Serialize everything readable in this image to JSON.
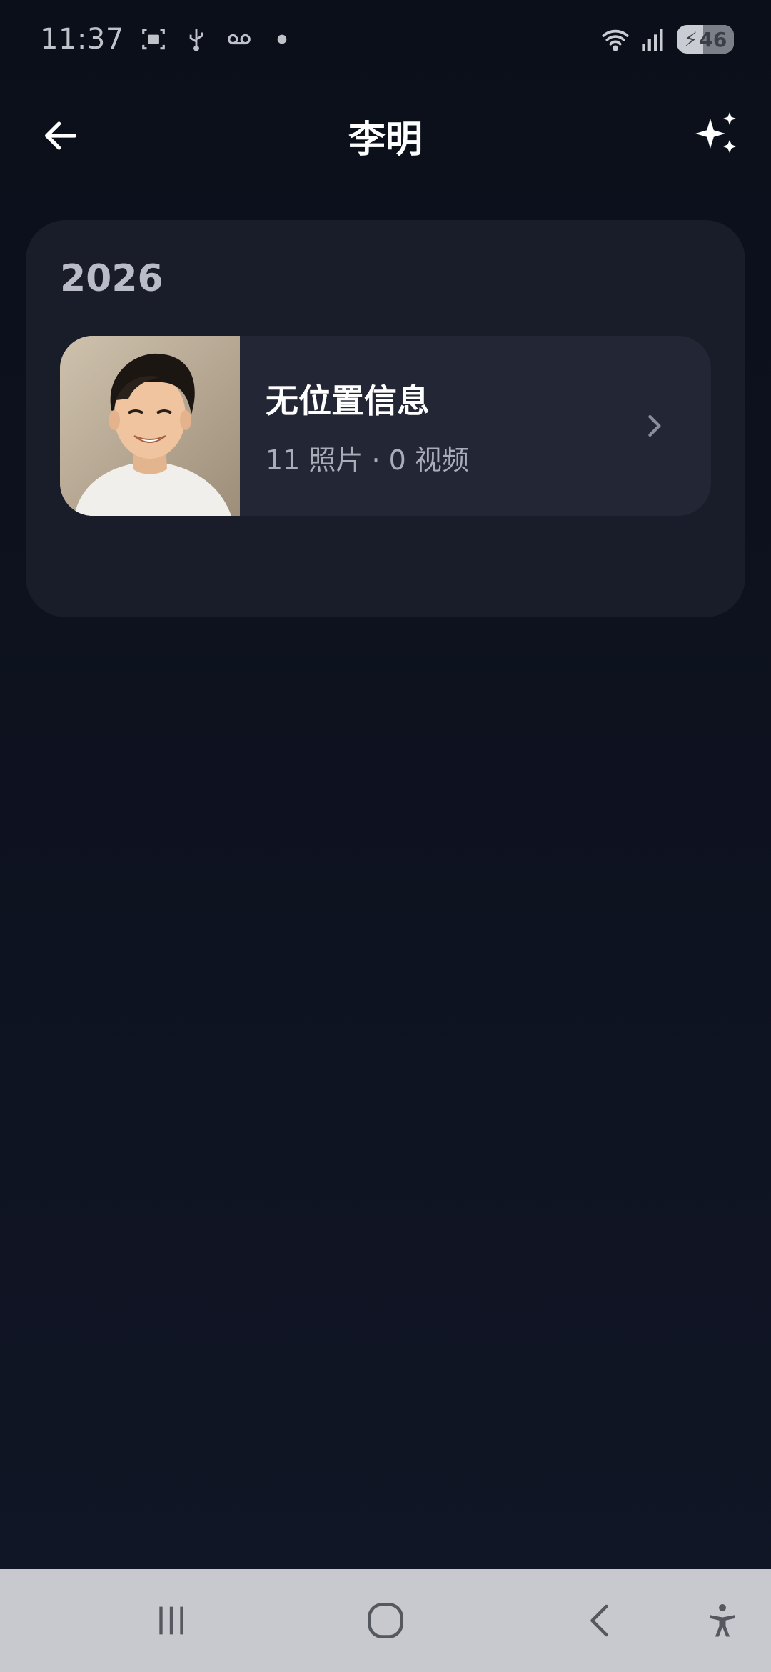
{
  "status_bar": {
    "time": "11:37",
    "left_icons": [
      "screenshot-icon",
      "usb-icon",
      "voicemail-icon",
      "dot-icon"
    ],
    "right_icons": [
      "wifi-icon",
      "signal-icon"
    ],
    "battery_level": "46"
  },
  "app_bar": {
    "title": "李明",
    "back_icon": "arrow-left-icon",
    "action_icon": "sparkles-icon"
  },
  "year_section": {
    "year": "2026",
    "items": [
      {
        "title": "无位置信息",
        "subtitle": "11 照片 · 0 视频",
        "thumbnail": "person-photo"
      }
    ]
  },
  "nav_bar": {
    "buttons": [
      "recent-apps-icon",
      "home-icon",
      "back-icon",
      "accessibility-icon"
    ]
  },
  "colors": {
    "background": "#0f1320",
    "card": "#191c29",
    "row": "#232635",
    "nav_bar": "#c7c9ce"
  }
}
